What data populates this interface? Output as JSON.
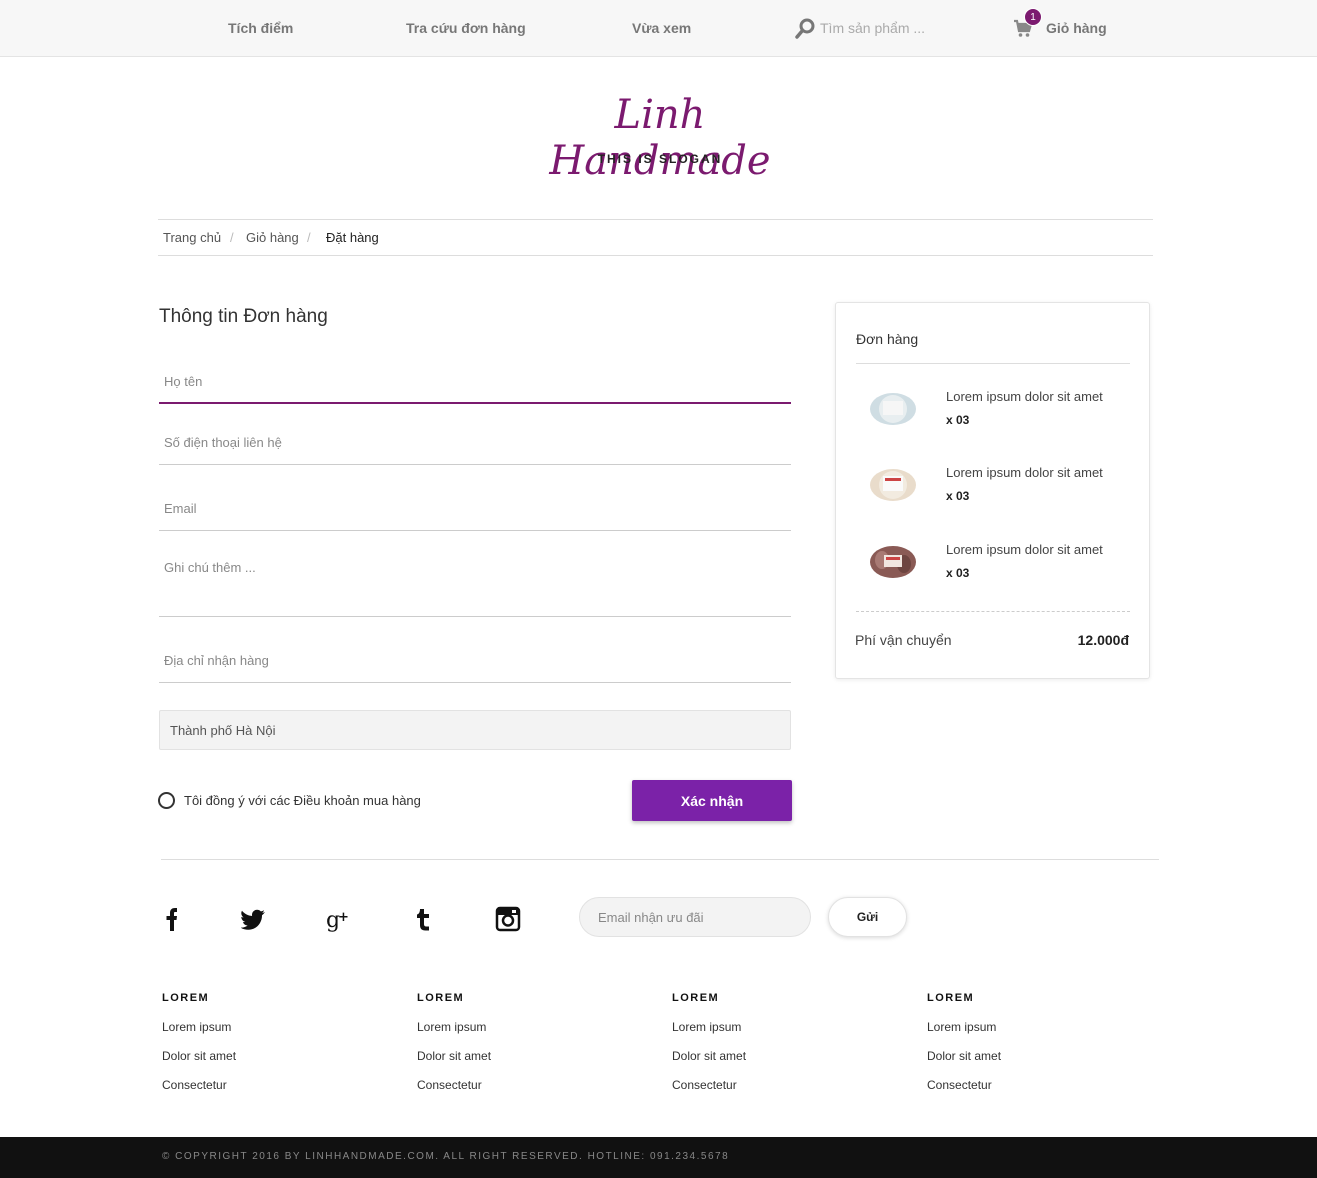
{
  "nav": {
    "items": [
      "Tích điểm",
      "Tra cứu đơn hàng",
      "Vừa xem"
    ],
    "search_placeholder": "Tìm sản phẩm ...",
    "cart_label": "Giỏ hàng",
    "cart_count": "1"
  },
  "brand": {
    "logo": "Linh Handmade",
    "slogan": "THIS IS SLOGAN",
    "accent_color": "#7b1a6f",
    "button_color": "#7b22a8"
  },
  "breadcrumb": [
    "Trang chủ",
    "Giỏ hàng",
    "Đặt hàng"
  ],
  "form": {
    "title": "Thông tin Đơn hàng",
    "name_placeholder": "Họ tên",
    "phone_placeholder": "Số điện thoại liên hệ",
    "email_placeholder": "Email",
    "note_placeholder": "Ghi chú thêm ...",
    "address_placeholder": "Địa chỉ nhận hàng",
    "city_value": "Thành phố Hà Nội",
    "agree_label": "Tôi đồng ý với các Điều khoản mua hàng",
    "submit_label": "Xác nhận"
  },
  "order": {
    "title": "Đơn hàng",
    "items": [
      {
        "name": "Lorem ipsum dolor sit amet",
        "qty": "x 03",
        "thumb_color": "#cfdde3"
      },
      {
        "name": "Lorem ipsum dolor sit amet",
        "qty": "x 03",
        "thumb_color": "#e9dccb"
      },
      {
        "name": "Lorem ipsum dolor sit amet",
        "qty": "x 03",
        "thumb_color": "#8a5a55"
      }
    ],
    "shipping_label": "Phí vận chuyển",
    "shipping_value": "12.000đ"
  },
  "footer": {
    "social_icons": [
      "facebook-icon",
      "twitter-icon",
      "google-plus-icon",
      "tumblr-icon",
      "instagram-icon"
    ],
    "newsletter_placeholder": "Email nhận ưu đãi",
    "newsletter_button": "Gửi",
    "columns": [
      {
        "title": "LOREM",
        "links": [
          "Lorem ipsum",
          "Dolor sit amet",
          "Consectetur"
        ]
      },
      {
        "title": "LOREM",
        "links": [
          "Lorem ipsum",
          "Dolor sit amet",
          "Consectetur"
        ]
      },
      {
        "title": "LOREM",
        "links": [
          "Lorem ipsum",
          "Dolor sit amet",
          "Consectetur"
        ]
      },
      {
        "title": "LOREM",
        "links": [
          "Lorem ipsum",
          "Dolor sit amet",
          "Consectetur"
        ]
      }
    ],
    "copyright": "© COPYRIGHT 2016 BY LINHHANDMADE.COM. ALL RIGHT RESERVED. HOTLINE: 091.234.5678"
  }
}
